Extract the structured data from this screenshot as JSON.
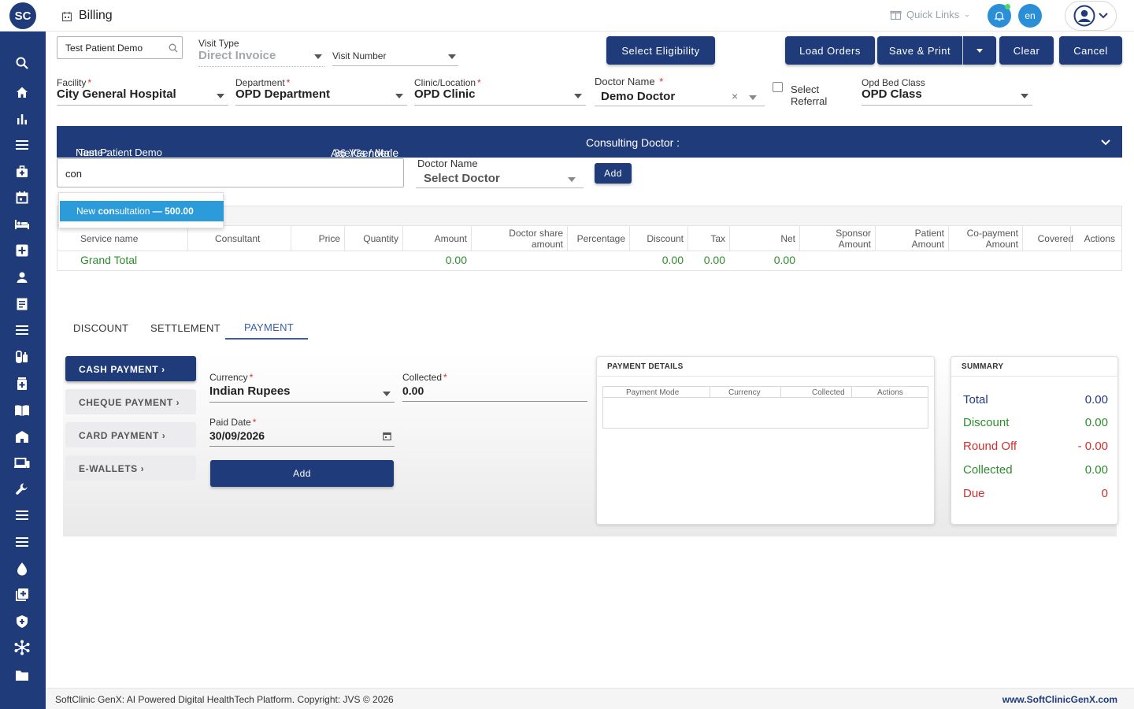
{
  "app": {
    "logo_text": "SC",
    "page_title": "Billing"
  },
  "header": {
    "quick_links": "Quick Links",
    "lang": "en"
  },
  "colors": {
    "primary": "#1f3b7a",
    "accent": "#2a8fd6",
    "green": "#2e8b2e",
    "red": "#d32f2f"
  },
  "form": {
    "patient_search": "Test Patient Demo",
    "visit_type_label": "Visit Type",
    "visit_type_value": "Direct Invoice",
    "visit_number_label": "Visit Number",
    "facility_label": "Facility",
    "facility_value": "City General Hospital",
    "department_label": "Department",
    "department_value": "OPD Department",
    "clinic_label": "Clinic/Location",
    "clinic_value": "OPD Clinic",
    "doctor_label": "Doctor Name",
    "doctor_value": "Demo Doctor",
    "referral_label_1": "Select",
    "referral_label_2": "Referral",
    "bed_class_label": "Opd Bed Class",
    "bed_class_value": "OPD Class",
    "req": "*"
  },
  "actions": {
    "select_eligibility": "Select Eligibility",
    "load_orders": "Load Orders",
    "save_print": "Save & Print",
    "clear": "Clear",
    "cancel": "Cancel"
  },
  "banner": {
    "name_label": "Name :",
    "name_value": "Test Patient Demo",
    "age_label": "Age/Gender :",
    "age_value": "36 Yrs / Male",
    "consulting_label": "Consulting Doctor :"
  },
  "service": {
    "query": "con",
    "doctor_label": "Doctor Name",
    "doctor_placeholder": "Select Doctor",
    "add_label": "Add",
    "suggestion_pre": "New ",
    "suggestion_match": "con",
    "suggestion_post": "sultation",
    "suggestion_price": "— 500.00"
  },
  "table": {
    "headers": {
      "service_name": "Service name",
      "consultant": "Consultant",
      "price": "Price",
      "quantity": "Quantity",
      "amount": "Amount",
      "doctor_share_1": "Doctor share",
      "doctor_share_2": "amount",
      "percentage": "Percentage",
      "discount": "Discount",
      "tax": "Tax",
      "net": "Net",
      "sponsor_1": "Sponsor",
      "sponsor_2": "Amount",
      "patient_1": "Patient",
      "patient_2": "Amount",
      "copay_1": "Co-payment",
      "copay_2": "Amount",
      "covered": "Covered",
      "actions": "Actions"
    },
    "grand_total_label": "Grand Total",
    "grand_total_amount": "0.00",
    "grand_total_discount": "0.00",
    "grand_total_tax": "0.00",
    "grand_total_net": "0.00"
  },
  "tabs": {
    "discount": "DISCOUNT",
    "settlement": "SETTLEMENT",
    "payment": "PAYMENT"
  },
  "payment_methods": {
    "cash": "CASH PAYMENT ›",
    "cheque": "CHEQUE PAYMENT ›",
    "card": "CARD PAYMENT ›",
    "ewallets": "E-WALLETS ›"
  },
  "payment_form": {
    "currency_label": "Currency",
    "currency_value": "Indian Rupees",
    "collected_label": "Collected",
    "collected_value": "0.00",
    "paid_date_label": "Paid Date",
    "paid_date_value": "30/09/2026",
    "add_label": "Add"
  },
  "payment_details": {
    "title": "PAYMENT DETAILS",
    "col_mode": "Payment Mode",
    "col_currency": "Currency",
    "col_collected": "Collected",
    "col_actions": "Actions"
  },
  "summary": {
    "title": "SUMMARY",
    "total_label": "Total",
    "total_value": "0.00",
    "discount_label": "Discount",
    "discount_value": "0.00",
    "roundoff_label": "Round Off",
    "roundoff_value": "- 0.00",
    "collected_label": "Collected",
    "collected_value": "0.00",
    "due_label": "Due",
    "due_value": "0"
  },
  "footer": {
    "copyright": "SoftClinic GenX: AI Powered Digital HealthTech Platform. Copyright: JVS © 2026",
    "website": "www.SoftClinicGenX.com"
  },
  "sidebar_icons": [
    "search-icon",
    "home-icon",
    "analytics-icon",
    "menu-icon",
    "medical-bag-icon",
    "calendar-icon",
    "bed-icon",
    "medical-plus-icon",
    "person-icon",
    "document-icon",
    "list-icon",
    "pharmacy-icon",
    "medicine-box-icon",
    "book-icon",
    "building-icon",
    "devices-icon",
    "wrench-icon",
    "menu-icon-2",
    "menu-icon-3",
    "blood-drop-icon",
    "add-box-icon",
    "shield-icon",
    "hub-icon",
    "folder-icon"
  ]
}
